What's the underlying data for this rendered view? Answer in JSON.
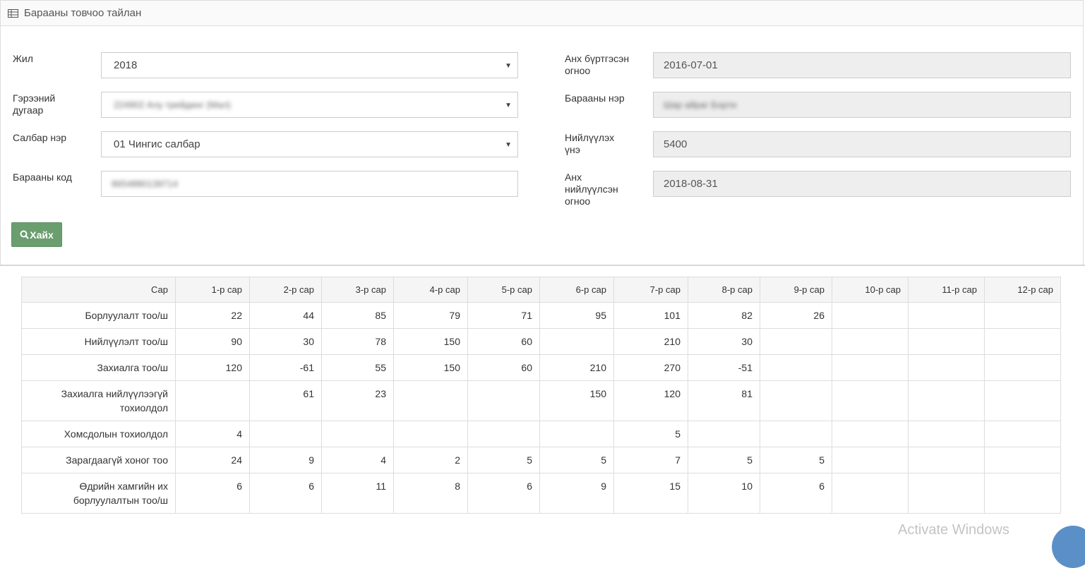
{
  "header": {
    "title": "Барааны товчоо тайлан",
    "icon": "table-icon"
  },
  "form": {
    "year": {
      "label": "Жил",
      "value": "2018"
    },
    "contract": {
      "label": "Гэрээний дугаар",
      "value": "224902 Алу трейдинг (Мал)"
    },
    "branch": {
      "label": "Салбар нэр",
      "value": "01 Чингис салбар"
    },
    "code": {
      "label": "Барааны код",
      "value": "8654880139714"
    },
    "registered": {
      "label": "Анх бүртгэсэн огноо",
      "value": "2016-07-01"
    },
    "product_name": {
      "label": "Барааны нэр",
      "value": "Шар айраг Борти"
    },
    "price": {
      "label": "Нийлүүлэх үнэ",
      "value": "5400"
    },
    "first_supply": {
      "label": "Анх нийлүүлсэн огноо",
      "value": "2018-08-31"
    },
    "search_label": "Хайх"
  },
  "table": {
    "headers": [
      "Сар",
      "1-р сар",
      "2-р сар",
      "3-р сар",
      "4-р сар",
      "5-р сар",
      "6-р сар",
      "7-р сар",
      "8-р сар",
      "9-р сар",
      "10-р сар",
      "11-р сар",
      "12-р сар"
    ],
    "rows": [
      [
        "Борлуулалт тоо/ш",
        "22",
        "44",
        "85",
        "79",
        "71",
        "95",
        "101",
        "82",
        "26",
        "",
        "",
        ""
      ],
      [
        "Нийлүүлэлт тоо/ш",
        "90",
        "30",
        "78",
        "150",
        "60",
        "",
        "210",
        "30",
        "",
        "",
        "",
        ""
      ],
      [
        "Захиалга тоо/ш",
        "120",
        "-61",
        "55",
        "150",
        "60",
        "210",
        "270",
        "-51",
        "",
        "",
        "",
        ""
      ],
      [
        "Захиалга нийлүүлээгүй тохиолдол",
        "",
        "61",
        "23",
        "",
        "",
        "150",
        "120",
        "81",
        "",
        "",
        "",
        ""
      ],
      [
        "Хомсдолын тохиолдол",
        "4",
        "",
        "",
        "",
        "",
        "",
        "5",
        "",
        "",
        "",
        "",
        ""
      ],
      [
        "Зарагдаагүй хоног тоо",
        "24",
        "9",
        "4",
        "2",
        "5",
        "5",
        "7",
        "5",
        "5",
        "",
        "",
        ""
      ],
      [
        "Өдрийн хамгийн их борлуулалтын тоо/ш",
        "6",
        "6",
        "11",
        "8",
        "6",
        "9",
        "15",
        "10",
        "6",
        "",
        "",
        ""
      ]
    ]
  },
  "watermark": "Activate Windows"
}
